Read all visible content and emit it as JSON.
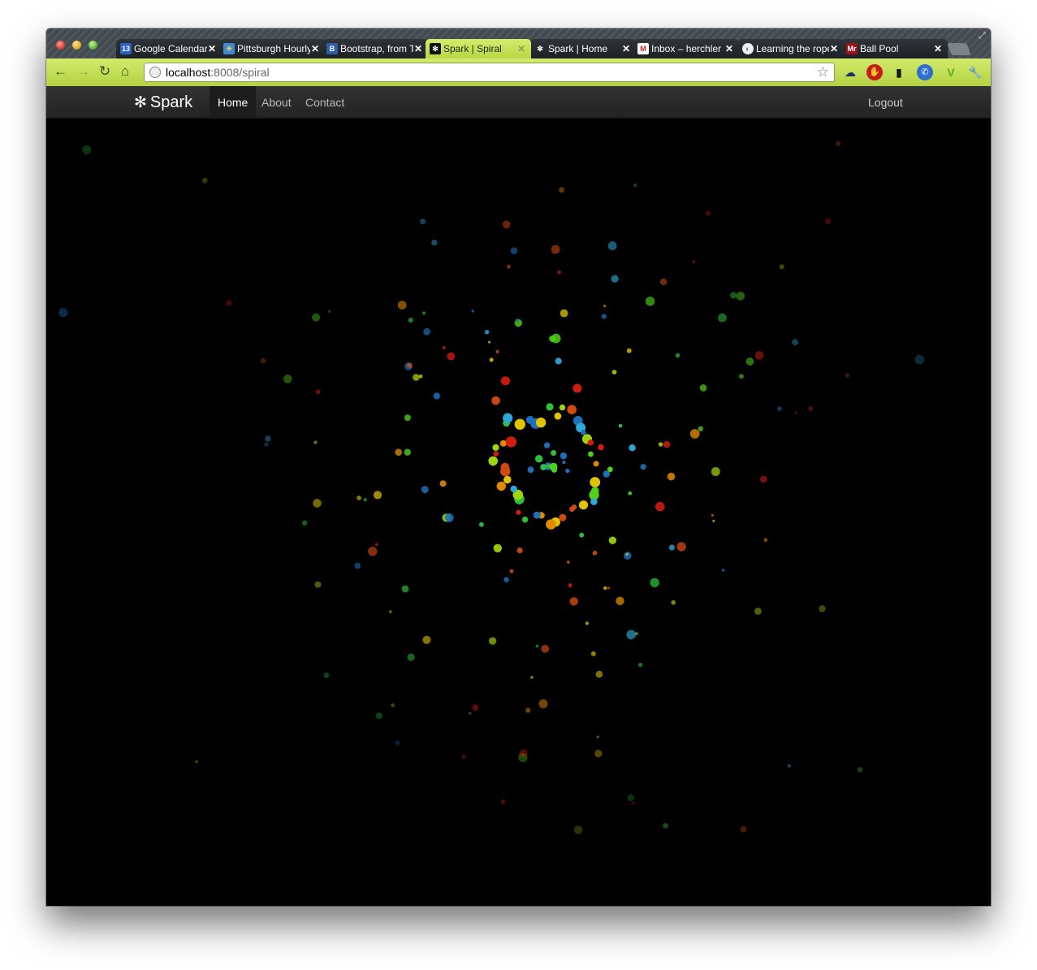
{
  "browser": {
    "tabs": [
      {
        "title": "Google Calendar",
        "favicon_text": "13",
        "favicon_color": "#2a62c9"
      },
      {
        "title": "Pittsburgh Hourly",
        "favicon_text": "☀",
        "favicon_color": "#3a8ad6"
      },
      {
        "title": "Bootstrap, from Twitter",
        "favicon_text": "B",
        "favicon_color": "#2c5fa8"
      },
      {
        "title": "Spark | Spiral",
        "favicon_text": "✻",
        "favicon_color": "#111111",
        "active": true
      },
      {
        "title": "Spark | Home",
        "favicon_text": "✻",
        "favicon_color": "#111111"
      },
      {
        "title": "Inbox – herchler",
        "favicon_text": "M",
        "favicon_color": "#c8281f"
      },
      {
        "title": "Learning the ropes",
        "favicon_text": "◐",
        "favicon_color": "#5b6b7a"
      },
      {
        "title": "Ball Pool",
        "favicon_text": "Mr",
        "favicon_color": "#a0101c"
      }
    ],
    "tab_close_glyph": "✕",
    "address": {
      "host": "localhost",
      "path": ":8008/spiral"
    },
    "nav_icons": [
      "back-arrow",
      "forward-arrow",
      "reload",
      "home"
    ],
    "extension_icons": [
      "cloud",
      "stop-sign",
      "phone-charger",
      "phone-call",
      "v-logo",
      "wrench"
    ]
  },
  "site": {
    "brand_icon": "✻",
    "brand": "Spark",
    "nav": [
      "Home",
      "About",
      "Contact"
    ],
    "active_nav": "Home",
    "logout": "Logout"
  },
  "visual": {
    "background": "#000000",
    "palette": [
      "#2fa8d8",
      "#1c6fb8",
      "#4fd11a",
      "#2fbf3a",
      "#9fd50d",
      "#e0c400",
      "#e08a00",
      "#d04a10",
      "#d11d10"
    ]
  }
}
